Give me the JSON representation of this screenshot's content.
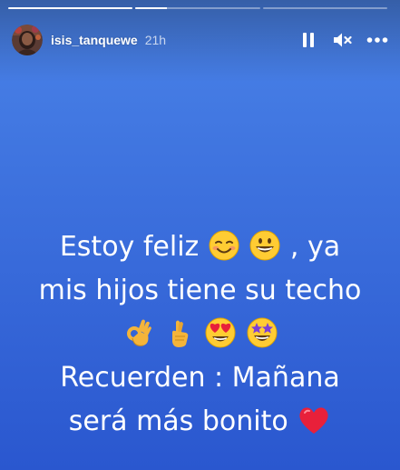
{
  "progress_segments": [
    {
      "progress": 1.0
    },
    {
      "progress": 0.25
    },
    {
      "progress": 0.0
    }
  ],
  "header": {
    "username": "isis_tanquewe",
    "timestamp": "21h"
  },
  "controls": {
    "pause_icon": "pause-icon",
    "mute_icon": "speaker-muted-icon",
    "more_icon": "more-horizontal-icon"
  },
  "story": {
    "background_top": "#4a83e8",
    "background_bottom": "#2a57cf",
    "line1_a": "Estoy feliz",
    "line1_b": ", ya",
    "line2": "mis hijos tiene su techo",
    "line3_emojis": [
      "ok-hand-emoji",
      "crossed-fingers-emoji",
      "heart-eyes-emoji",
      "star-struck-emoji"
    ],
    "line4": "Recuerden : Mañana",
    "line5": "será más bonito",
    "line1_emojis": [
      "smiling-face-emoji",
      "grinning-face-emoji"
    ],
    "line5_emoji": "red-heart-emoji"
  }
}
